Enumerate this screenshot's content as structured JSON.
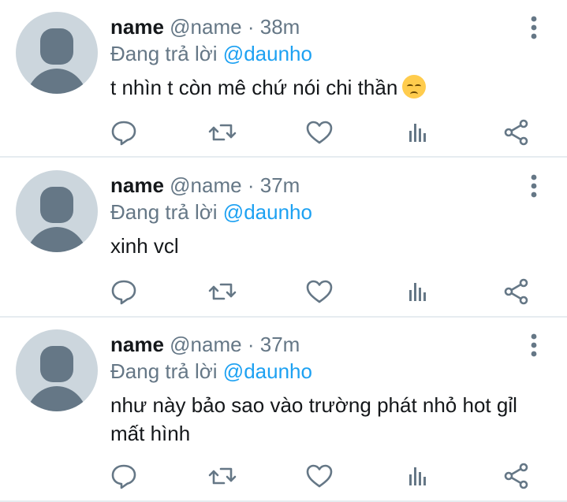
{
  "tweets": [
    {
      "name": "name",
      "handle": "@name",
      "separator": "·",
      "time": "38m",
      "reply_prefix": "Đang trả lời",
      "reply_to": "@daunho",
      "text": "t nhìn t còn mê chứ nói chi thần",
      "emoji": "disappointed-face"
    },
    {
      "name": "name",
      "handle": "@name",
      "separator": "·",
      "time": "37m",
      "reply_prefix": "Đang trả lời",
      "reply_to": "@daunho",
      "text": "xinh vcl"
    },
    {
      "name": "name",
      "handle": "@name",
      "separator": "·",
      "time": "37m",
      "reply_prefix": "Đang trả lời",
      "reply_to": "@daunho",
      "text": "như này bảo sao vào trường phát nhỏ hot gỉl mất hình"
    }
  ],
  "actions": [
    "reply-icon",
    "retweet-icon",
    "like-icon",
    "analytics-icon",
    "share-icon"
  ],
  "colors": {
    "text": "#14171a",
    "secondary": "#657786",
    "link": "#1da1f2",
    "avatar_bg": "#ccd6dd",
    "divider": "#e6ecf0"
  }
}
